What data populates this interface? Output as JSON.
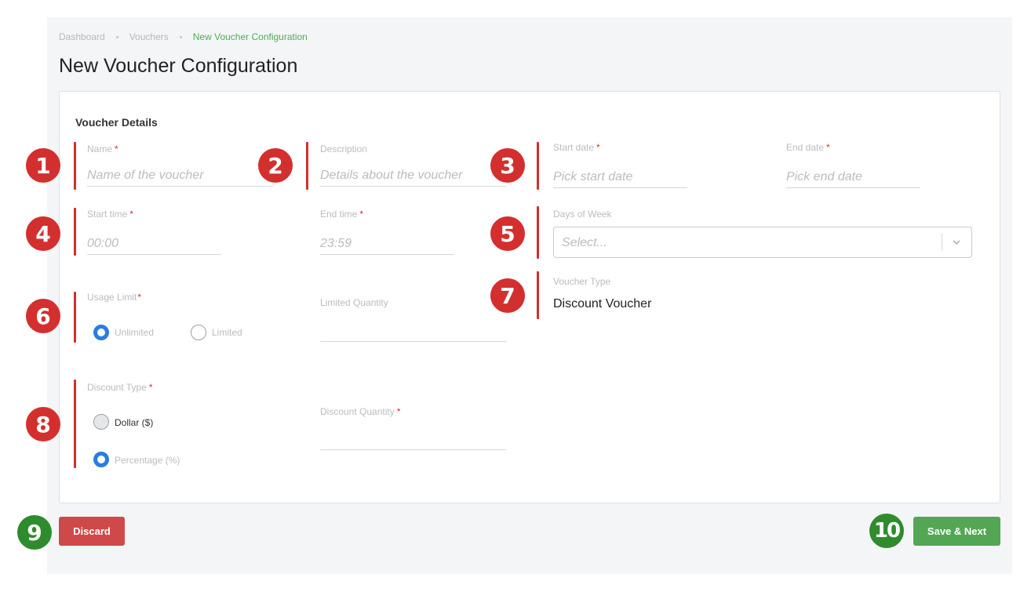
{
  "breadcrumb": {
    "items": [
      "Dashboard",
      "Vouchers",
      "New Voucher Configuration"
    ]
  },
  "page_title": "New Voucher Configuration",
  "section_title": "Voucher Details",
  "markers": [
    "1",
    "2",
    "3",
    "4",
    "5",
    "6",
    "7",
    "8",
    "9",
    "10"
  ],
  "form": {
    "name": {
      "label": "Name",
      "required": "*",
      "placeholder": "Name of the voucher"
    },
    "description": {
      "label": "Description",
      "placeholder": "Details about the voucher"
    },
    "start_date": {
      "label": "Start date",
      "required": "*",
      "placeholder": "Pick start date"
    },
    "end_date": {
      "label": "End date",
      "required": "*",
      "placeholder": "Pick end date"
    },
    "start_time": {
      "label": "Start time",
      "required": "*",
      "placeholder": "00:00"
    },
    "end_time": {
      "label": "End time",
      "required": "*",
      "placeholder": "23:59"
    },
    "days_of_week": {
      "label": "Days of Week",
      "placeholder": "Select..."
    },
    "usage_limit": {
      "label": "Usage Limit",
      "required": "*",
      "options": [
        "Unlimited",
        "Limited"
      ],
      "selected": "Unlimited"
    },
    "limited_quantity": {
      "label": "Limited Quantity",
      "value": ""
    },
    "voucher_type": {
      "label": "Voucher Type",
      "value": "Discount Voucher"
    },
    "discount_type": {
      "label": "Discount Type",
      "required": "*",
      "options": [
        "Dollar ($)",
        "Percentage (%)"
      ],
      "selected": "Percentage (%)"
    },
    "discount_quantity": {
      "label": "Discount Quantity",
      "required": "*",
      "value": ""
    }
  },
  "actions": {
    "discard_label": "Discard",
    "save_label": "Save & Next"
  },
  "colors": {
    "marker_red": "#d32f2f",
    "marker_green": "#2e8b2e",
    "accent_green": "#4caf50",
    "radio_blue": "#2b7de0",
    "discard": "#d0494a",
    "save": "#53a653"
  },
  "icons": {
    "select_chevron": "chevron-down-icon"
  }
}
